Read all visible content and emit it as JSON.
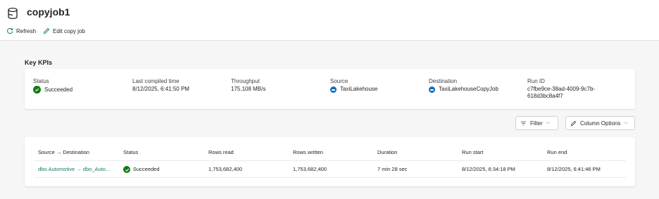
{
  "header": {
    "title": "copyjob1",
    "refresh_label": "Refresh",
    "edit_label": "Edit copy job"
  },
  "kpis": {
    "heading": "Key KPIs",
    "status": {
      "label": "Status",
      "value": "Succeeded"
    },
    "compiled": {
      "label": "Last compiled time",
      "value": "8/12/2025, 6:41:50 PM"
    },
    "throughput": {
      "label": "Throughput",
      "value": "175.108 MB/s"
    },
    "source": {
      "label": "Source",
      "value": "TaxiLakehouse"
    },
    "destination": {
      "label": "Destination",
      "value": "TaxiLakehouseCopyJob"
    },
    "run_id": {
      "label": "Run ID",
      "value": "c7fbe9ce-38ad-4009-9c7b-618d3bc8a4f7"
    }
  },
  "controls": {
    "filter_label": "Filter",
    "column_options_label": "Column Options"
  },
  "table": {
    "headers": {
      "source_dest": "Source → Destination",
      "status": "Status",
      "rows_read": "Rows read",
      "rows_written": "Rows written",
      "duration": "Duration",
      "run_start": "Run start",
      "run_end": "Run end"
    },
    "rows": [
      {
        "source_dest": "dbo.Automotive → dbo_Auto...",
        "status": "Succeeded",
        "rows_read": "1,753,682,400",
        "rows_written": "1,753,682,400",
        "duration": "7 min 28 sec",
        "run_start": "8/12/2025, 6:34:18 PM",
        "run_end": "8/12/2025, 6:41:46 PM"
      }
    ]
  },
  "colors": {
    "success": "#107c10",
    "link": "#0f7b6c",
    "lakehouse": "#0f6cbd"
  }
}
